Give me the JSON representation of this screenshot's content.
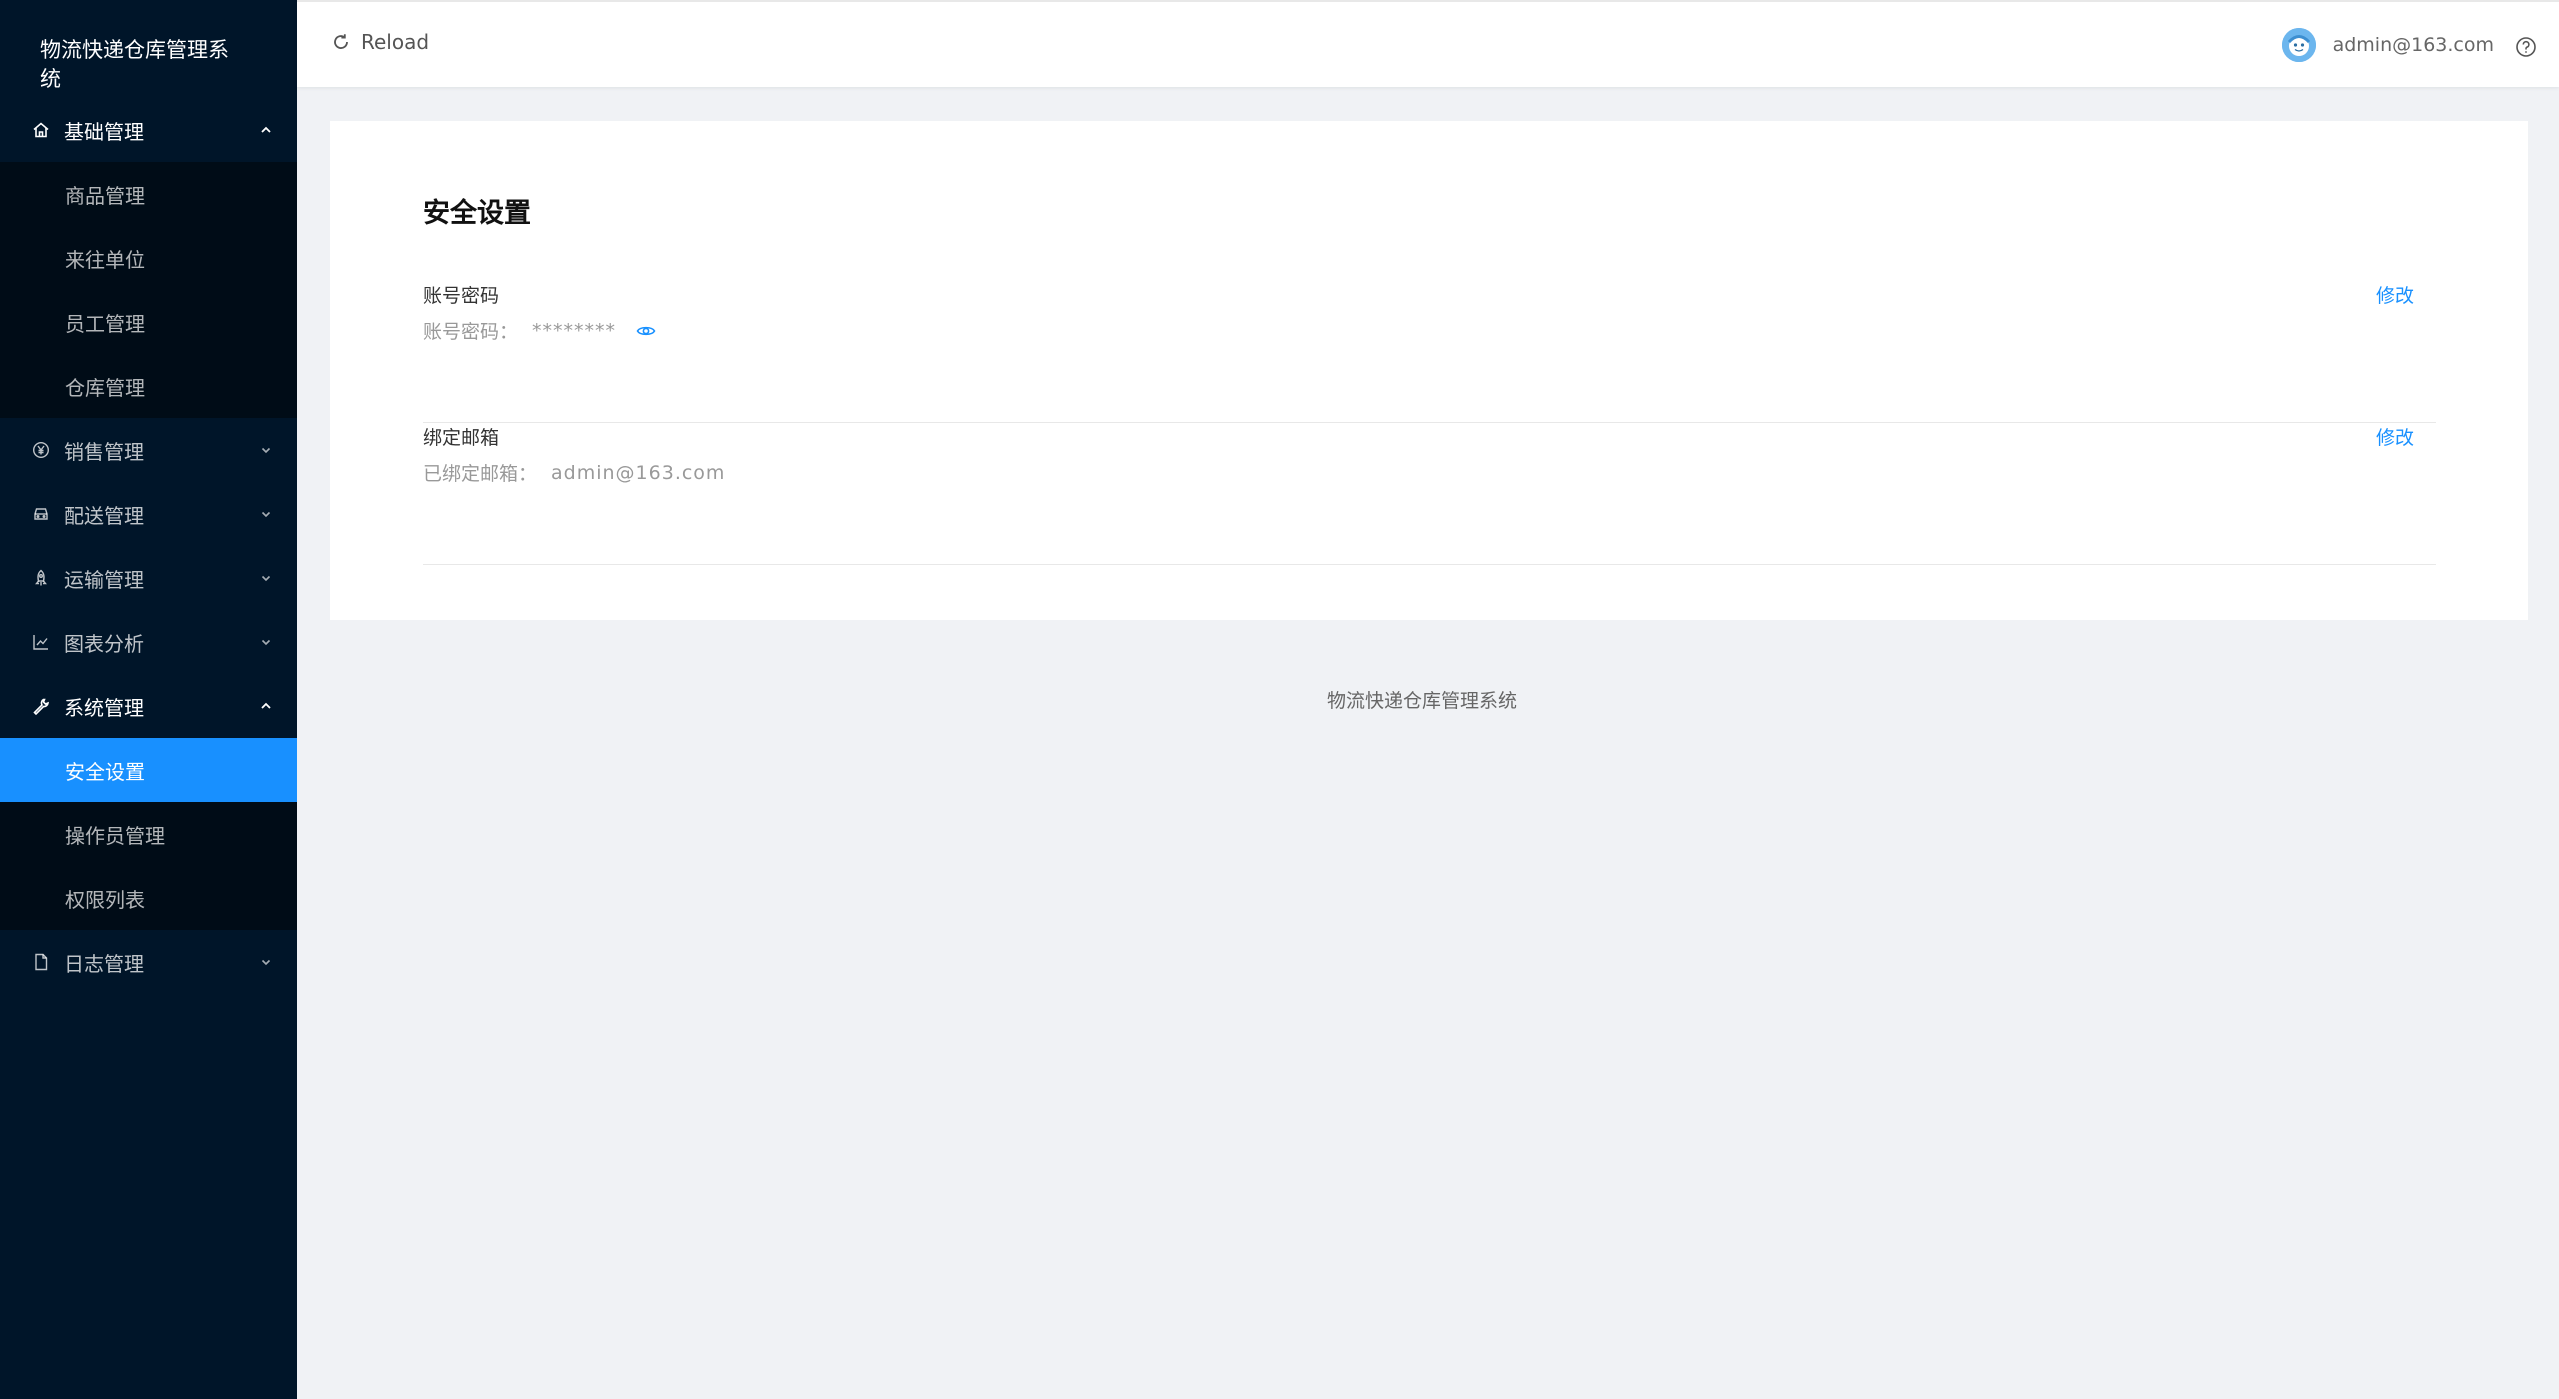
{
  "app": {
    "title": "物流快递仓库管理系统"
  },
  "sidebar": {
    "groups": [
      {
        "label": "基础管理",
        "icon": "home-icon",
        "open": true,
        "items": [
          "商品管理",
          "来往单位",
          "员工管理",
          "仓库管理"
        ]
      },
      {
        "label": "销售管理",
        "icon": "yen-icon",
        "open": false
      },
      {
        "label": "配送管理",
        "icon": "car-icon",
        "open": false
      },
      {
        "label": "运输管理",
        "icon": "rocket-icon",
        "open": false
      },
      {
        "label": "图表分析",
        "icon": "line-chart-icon",
        "open": false
      },
      {
        "label": "系统管理",
        "icon": "tool-icon",
        "open": true,
        "items": [
          "安全设置",
          "操作员管理",
          "权限列表"
        ],
        "active": "安全设置"
      },
      {
        "label": "日志管理",
        "icon": "file-icon",
        "open": false
      }
    ]
  },
  "header": {
    "reload_label": "Reload",
    "username": "admin@163.com"
  },
  "security": {
    "title": "安全设置",
    "password": {
      "title": "账号密码",
      "desc_label": "账号密码：",
      "desc_value": "********",
      "action": "修改"
    },
    "email": {
      "title": "绑定邮箱",
      "desc_label": "已绑定邮箱：",
      "desc_value": "admin@163.com",
      "action": "修改"
    }
  },
  "footer": {
    "text": "物流快递仓库管理系统"
  },
  "colors": {
    "sidebar_bg": "#001529",
    "submenu_bg": "#000c17",
    "accent": "#1890ff",
    "page_bg": "#f0f2f5"
  }
}
